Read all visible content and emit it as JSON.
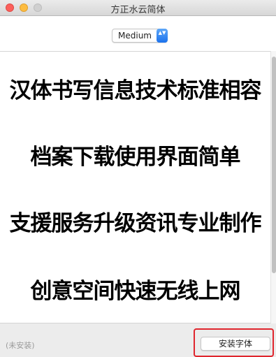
{
  "window": {
    "title": "方正水云简体"
  },
  "style_select": {
    "value": "Medium",
    "arrows": "▲▼"
  },
  "preview": {
    "lines": [
      "汉体书写信息技术标准相容",
      "档案下载使用界面简单",
      "支援服务升级资讯专业制作",
      "创意空间快速无线上网"
    ]
  },
  "footer": {
    "status": "(未安装)",
    "install_label": "安装字体"
  },
  "colors": {
    "highlight": "#e0262e",
    "select_accent": "#1b72ed"
  }
}
